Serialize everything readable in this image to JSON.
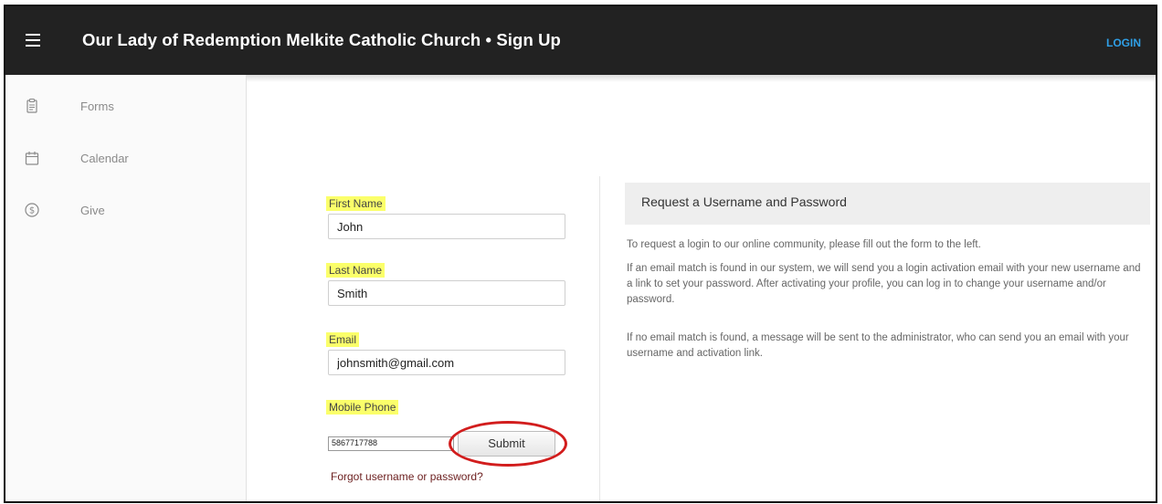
{
  "header": {
    "title": "Our Lady of Redemption Melkite Catholic Church • Sign Up",
    "login_label": "LOGIN",
    "menu_icon": "hamburger-menu-icon"
  },
  "sidebar": {
    "items": [
      {
        "label": "Forms",
        "icon": "clipboard-icon"
      },
      {
        "label": "Calendar",
        "icon": "calendar-icon"
      },
      {
        "label": "Give",
        "icon": "dollar-circle-icon"
      }
    ]
  },
  "form": {
    "first_name_label": "First Name",
    "first_name_value": "John",
    "last_name_label": "Last Name",
    "last_name_value": "Smith",
    "email_label": "Email",
    "email_value": "johnsmith@gmail.com",
    "phone_label": "Mobile Phone",
    "phone_value": "5867717788",
    "submit_label": "Submit",
    "forgot_link": "Forgot username or password?"
  },
  "info": {
    "title": "Request a Username and Password",
    "paragraphs": [
      "To request a login to our online community, please fill out the form to the left.",
      "If an email match is found in our system, we will send you a login activation email with your new username and a link to set your password. After activating your profile, you can log in to change your username and/or password.",
      "If no email match is found, a message will be sent to the administrator, who can send you an email with your username and activation link."
    ]
  },
  "colors": {
    "topbar": "#222222",
    "login_link": "#2f9fe6",
    "highlight": "#fbff6a",
    "annotation_circle": "#d21d1d",
    "forgot_link": "#6b1e1e"
  }
}
